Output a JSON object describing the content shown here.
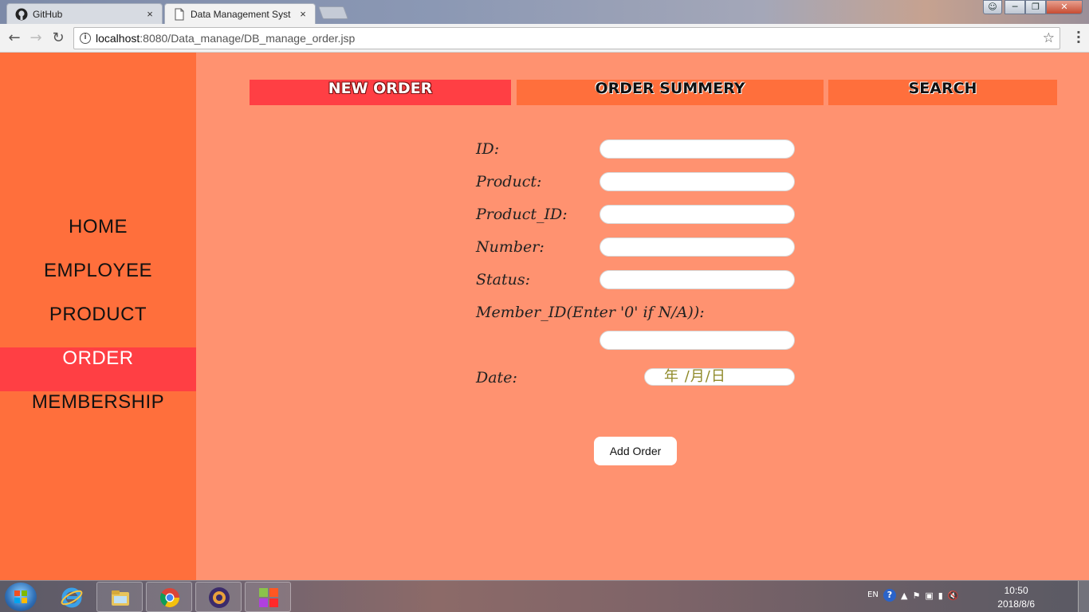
{
  "browser": {
    "tabs": [
      {
        "title": "GitHub",
        "close": "×"
      },
      {
        "title": "Data Management Syst",
        "close": "×"
      }
    ],
    "url_host": "localhost",
    "url_rest": ":8080/Data_manage/DB_manage_order.jsp"
  },
  "sidebar": {
    "items": [
      {
        "label": "HOME"
      },
      {
        "label": "EMPLOYEE"
      },
      {
        "label": "PRODUCT"
      },
      {
        "label": "ORDER"
      },
      {
        "label": "MEMBERSHIP"
      }
    ]
  },
  "top_tabs": {
    "new_order": "NEW ORDER",
    "summary": "ORDER SUMMERY",
    "search": "SEARCH"
  },
  "form": {
    "id_label": "ID:",
    "product_label": "Product:",
    "product_id_label": "Product_ID:",
    "number_label": "Number:",
    "status_label": "Status:",
    "member_label": "Member_ID(Enter '0' if N/A)):",
    "date_label": "Date:",
    "date_placeholder": "年 /月/日",
    "submit": "Add Order"
  },
  "taskbar": {
    "lang": "EN",
    "help": "?",
    "time": "10:50",
    "date": "2018/8/6"
  }
}
